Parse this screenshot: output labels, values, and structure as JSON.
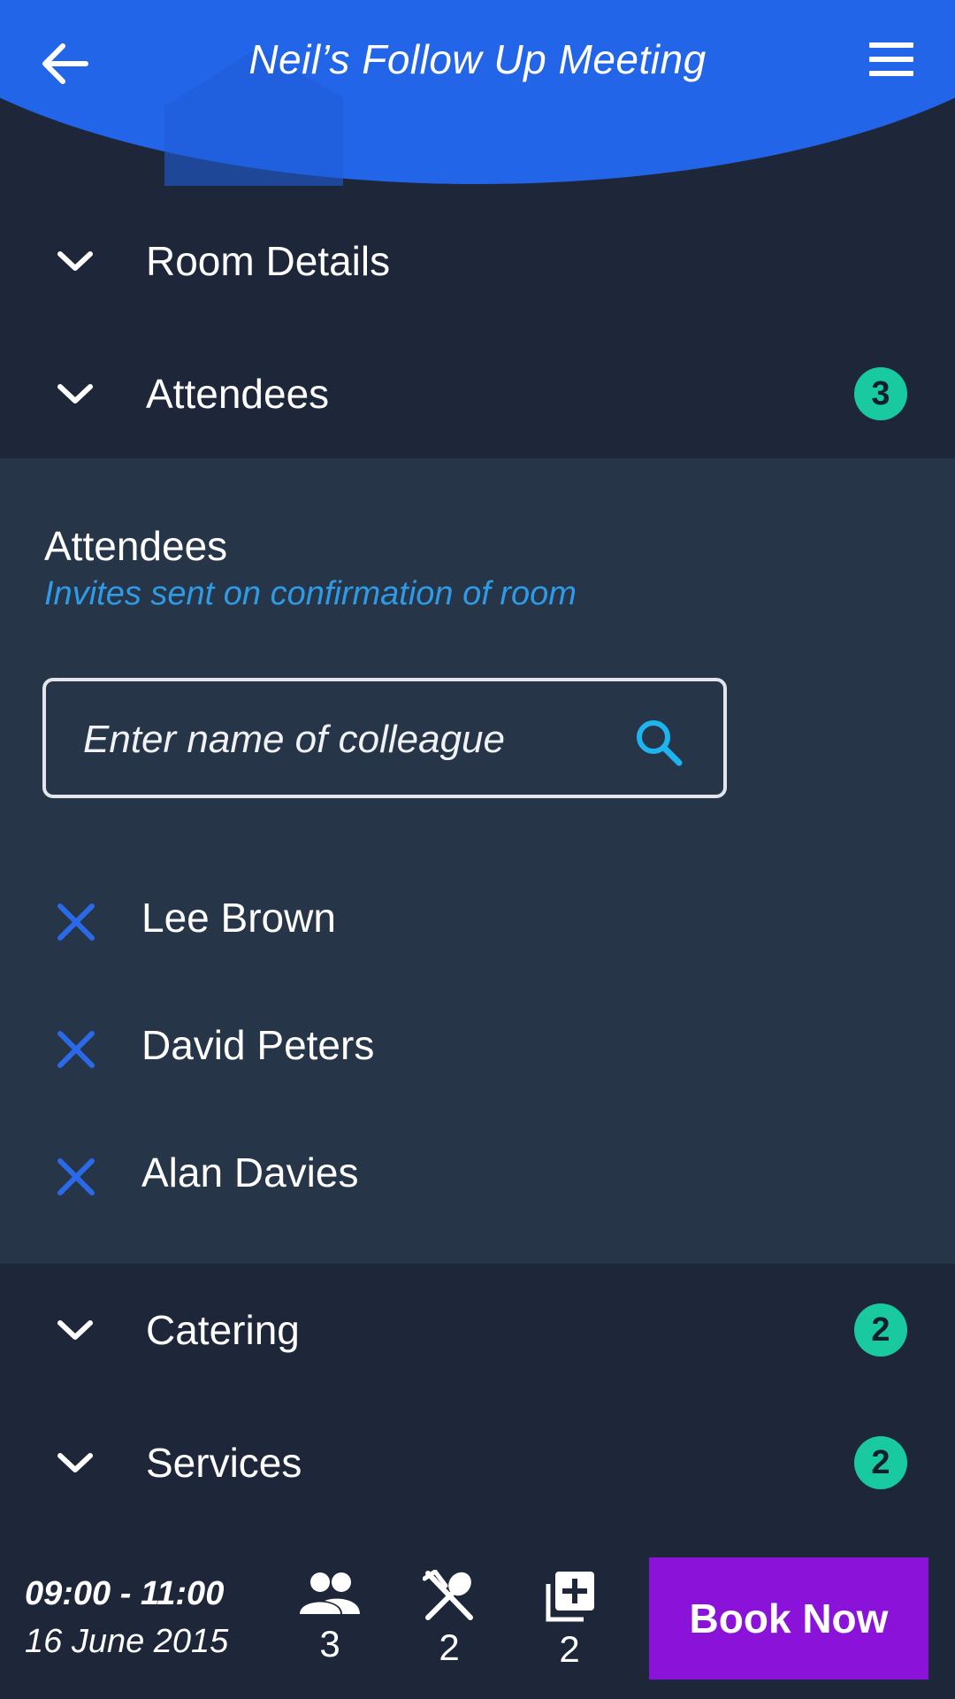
{
  "header": {
    "title": "Neil’s Follow Up Meeting",
    "back_icon": "arrow-left-icon",
    "menu_icon": "hamburger-menu-icon",
    "accent_color": "#2265e8"
  },
  "sections": {
    "room_details": {
      "label": "Room Details"
    },
    "attendees": {
      "label": "Attendees",
      "count": "3"
    },
    "catering": {
      "label": "Catering",
      "count": "2"
    },
    "services": {
      "label": "Services",
      "count": "2"
    }
  },
  "attendees_panel": {
    "title": "Attendees",
    "subtitle": "Invites sent on confirmation of room",
    "search_placeholder": "Enter name of colleague",
    "list": [
      "Lee Brown",
      "David Peters",
      "Alan Davies"
    ]
  },
  "footer": {
    "time": "09:00 - 11:00",
    "date": "16 June 2015",
    "attendee_count": "3",
    "catering_count": "2",
    "services_count": "2",
    "book_label": "Book Now",
    "book_color": "#8b12d8",
    "badge_color": "#19c9a0"
  }
}
